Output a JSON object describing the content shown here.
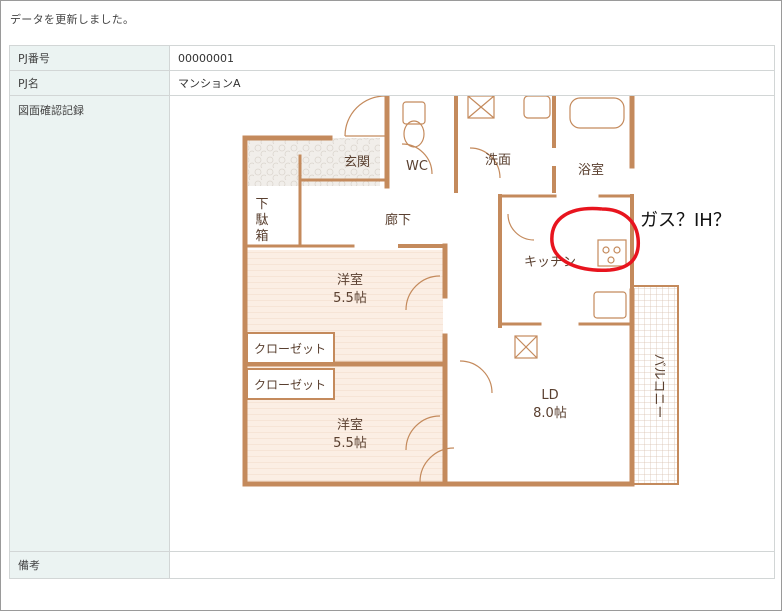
{
  "status_message": "データを更新しました。",
  "form": {
    "pj_number_label": "PJ番号",
    "pj_number_value": "00000001",
    "pj_name_label": "PJ名",
    "pj_name_value": "マンションA",
    "drawing_label": "図面確認記録",
    "notes_label": "備考",
    "notes_value": ""
  },
  "floor_plan": {
    "rooms": {
      "wc": "WC",
      "washroom": "洗面",
      "bathroom": "浴室",
      "entrance": "玄関",
      "shoe_box_1": "下",
      "shoe_box_2": "駄",
      "shoe_box_3": "箱",
      "corridor": "廊下",
      "kitchen": "キッチン",
      "western_room_1_name": "洋室",
      "western_room_1_size": "5.5帖",
      "closet_1": "クローゼット",
      "closet_2": "クローゼット",
      "western_room_2_name": "洋室",
      "western_room_2_size": "5.5帖",
      "ld_name": "LD",
      "ld_size": "8.0帖",
      "balcony": "バルコニー"
    },
    "annotation": "ガス？IH？",
    "colors": {
      "wall": "#c48a5c",
      "text": "#5a4030",
      "floor_fill": "#fbeee4",
      "annotation_circle": "#e8141e"
    }
  }
}
